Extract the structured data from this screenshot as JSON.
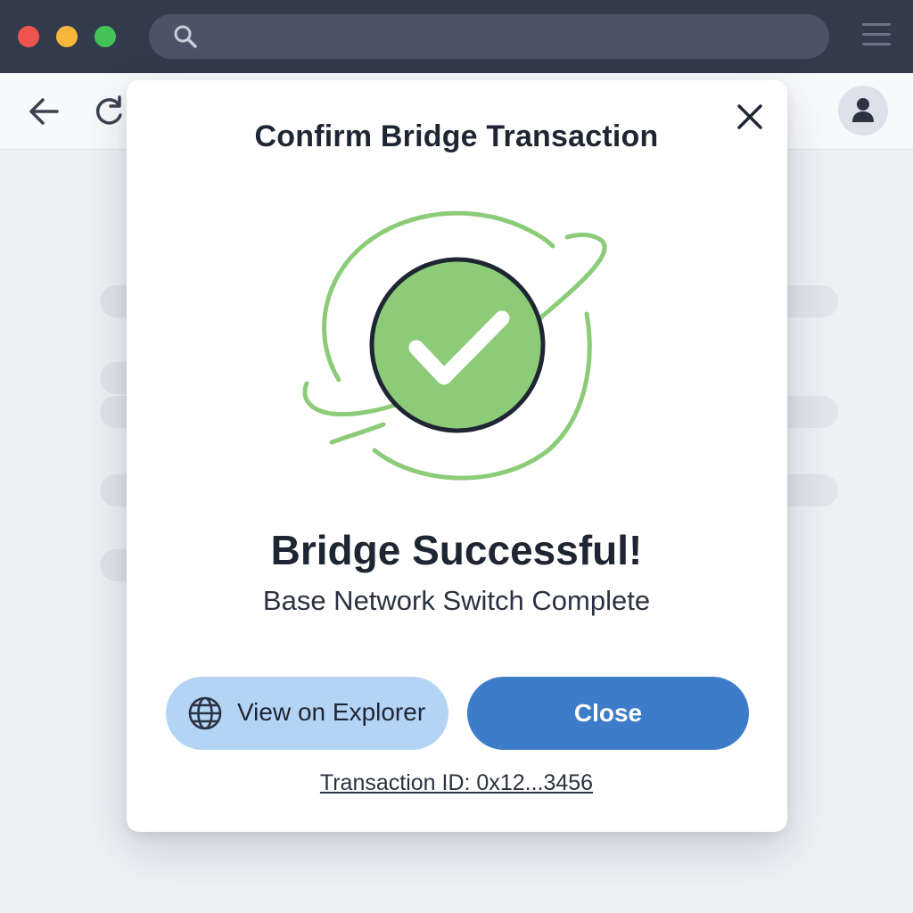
{
  "modal": {
    "title": "Confirm Bridge Transaction",
    "status_title": "Bridge Successful!",
    "status_subtitle": "Base Network Switch Complete",
    "explorer_label": "View on Explorer",
    "close_label": "Close",
    "transaction_link": "Transaction ID: 0x12...3456"
  },
  "icons": {
    "success": "check-circle-icon",
    "explorer": "globe-icon",
    "dismiss": "close-icon"
  },
  "colors": {
    "success": "#8ccc78",
    "primary_button": "#3d7cc9",
    "secondary_button": "#b3d4f5",
    "titlebar": "#323b4a"
  }
}
